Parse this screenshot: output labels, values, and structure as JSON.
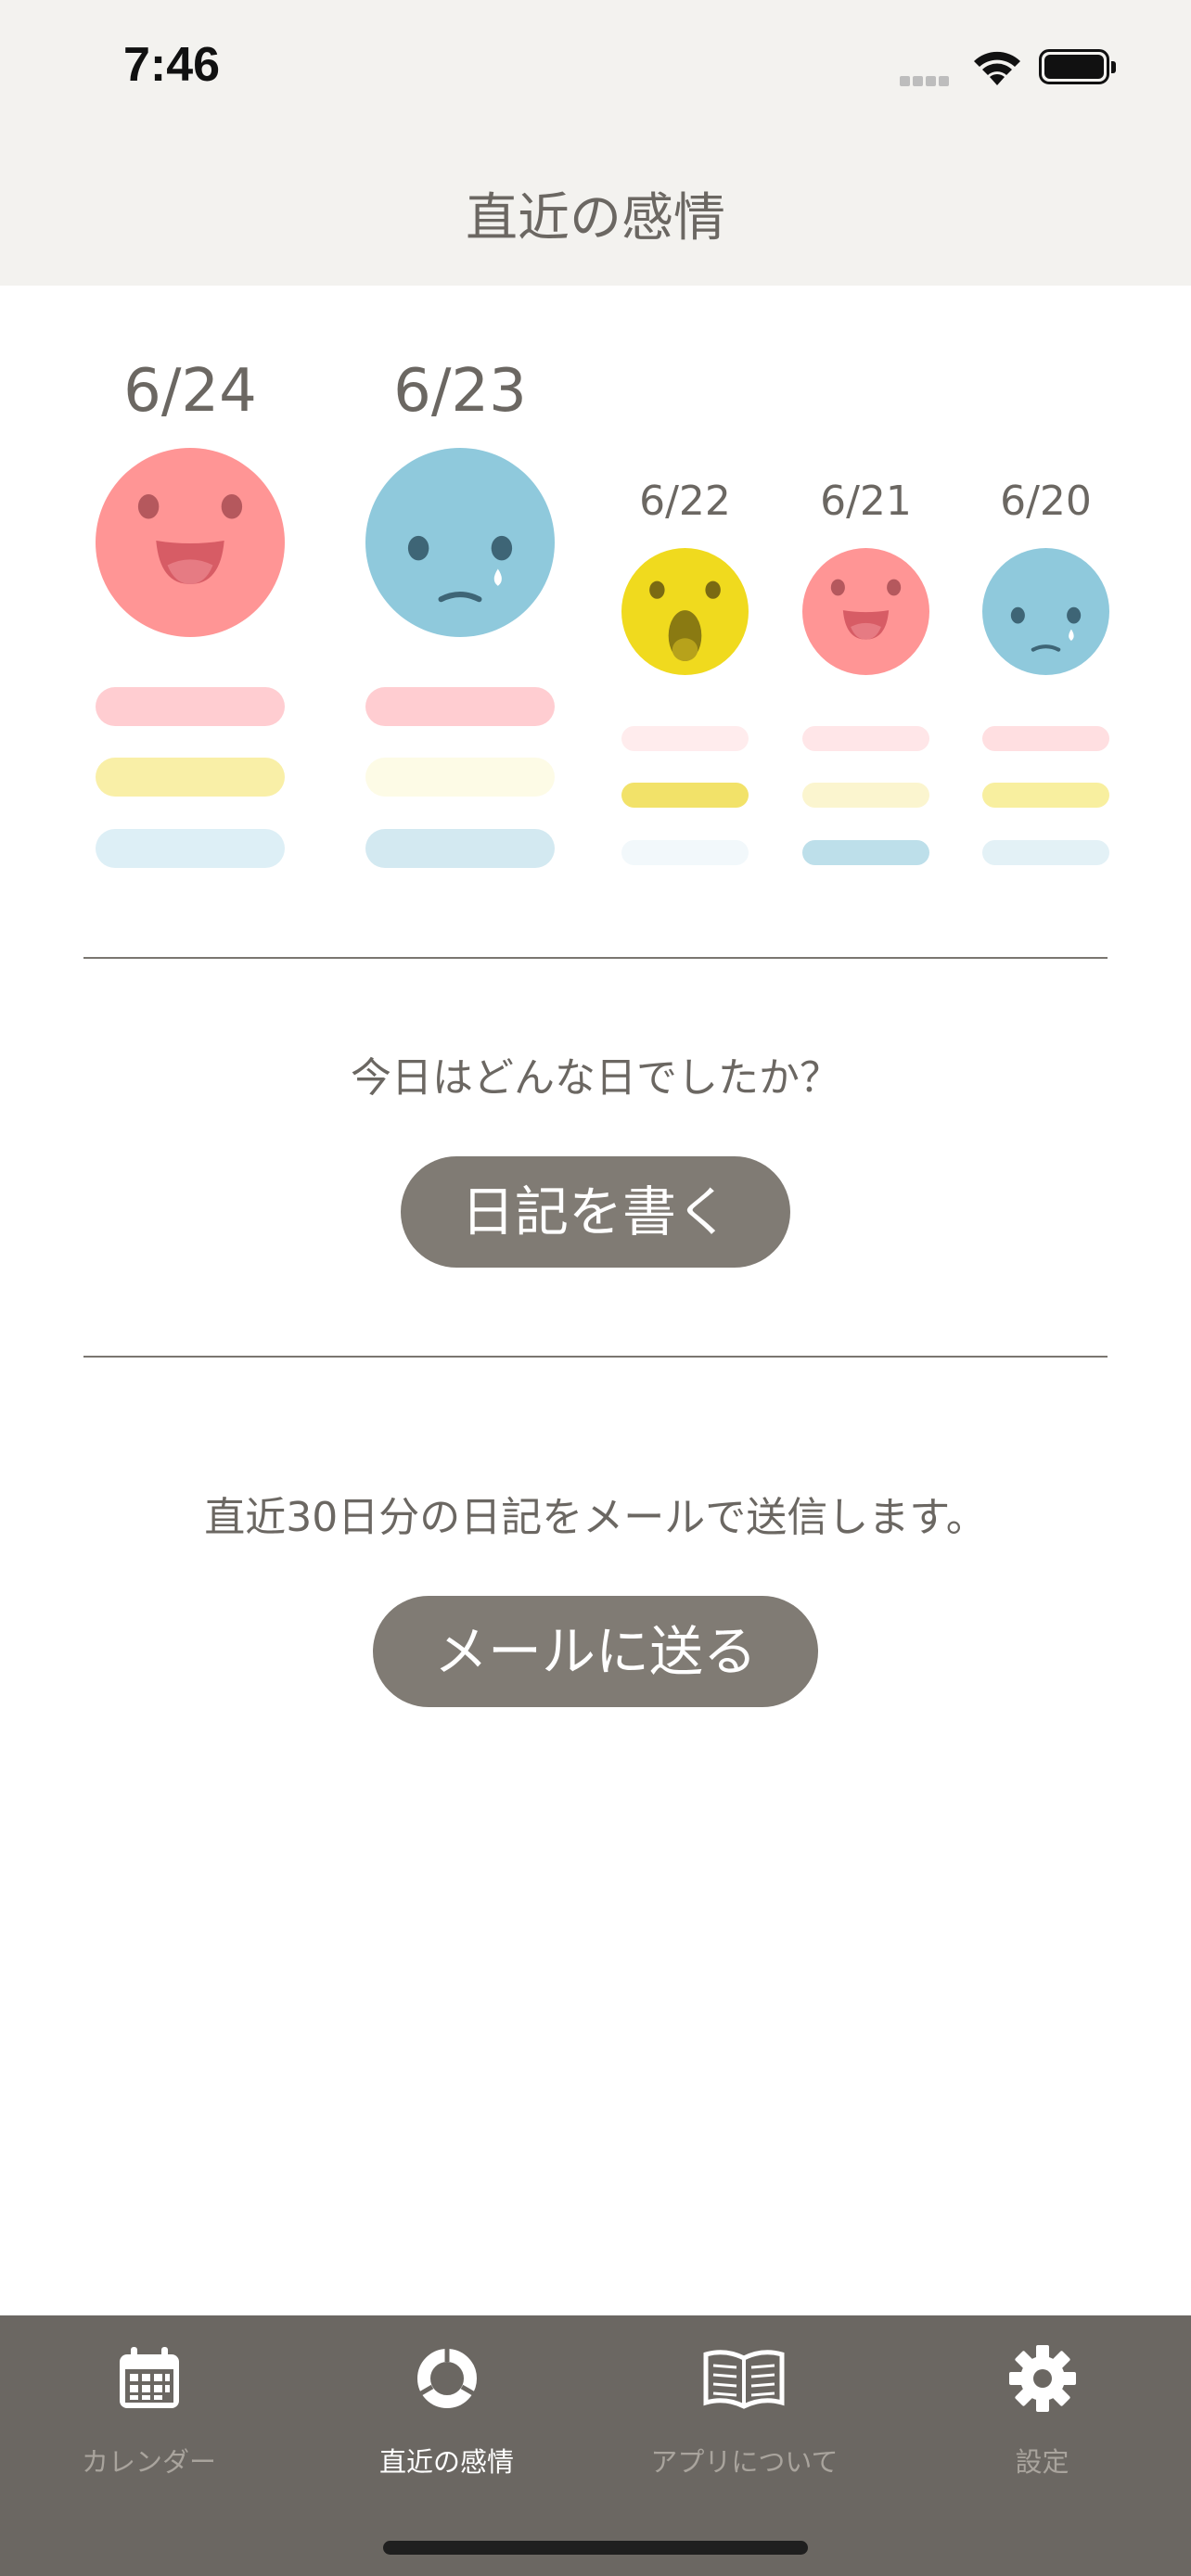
{
  "status_bar": {
    "time": "7:46"
  },
  "nav": {
    "title": "直近の感情"
  },
  "days": [
    {
      "date": "6/24",
      "mood": "happy"
    },
    {
      "date": "6/23",
      "mood": "sad"
    },
    {
      "date": "6/22",
      "mood": "surprised"
    },
    {
      "date": "6/21",
      "mood": "happy"
    },
    {
      "date": "6/20",
      "mood": "sad"
    }
  ],
  "write_section": {
    "prompt": "今日はどんな日でしたか？",
    "button_label": "日記を書く"
  },
  "mail_section": {
    "prompt": "直近30日分の日記をメールで送信します。",
    "button_label": "メールに送る"
  },
  "tabs": [
    {
      "label": "カレンダー",
      "icon": "calendar-icon"
    },
    {
      "label": "直近の感情",
      "icon": "ring-chart-icon",
      "active": true
    },
    {
      "label": "アプリについて",
      "icon": "book-icon"
    },
    {
      "label": "設定",
      "icon": "gear-icon"
    }
  ],
  "colors": {
    "happy": "#ff9595",
    "sad": "#8fc9dc",
    "surprised": "#f0da1e",
    "pink_bar": "#ffcdd1",
    "yellow_bar": "#f7ed9b",
    "blue_bar": "#d3e9f1",
    "header_bg": "#f3f2ef",
    "tab_bg": "#6b6762",
    "button_bg": "#807b74"
  }
}
